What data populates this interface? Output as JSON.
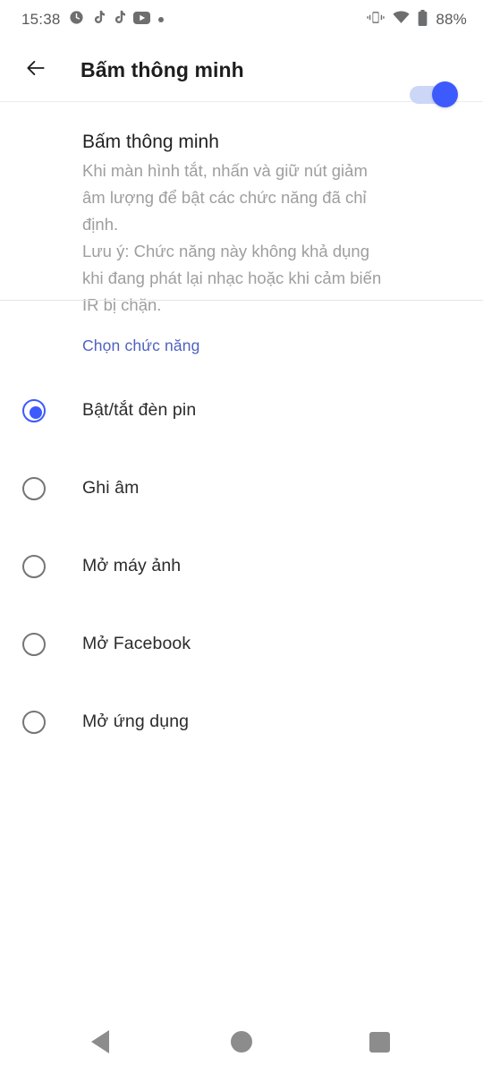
{
  "status_bar": {
    "time": "15:38",
    "battery_text": "88%",
    "left_icons": [
      "clock-icon",
      "tiktok-icon",
      "tiktok-icon",
      "youtube-icon",
      "notification-dot-icon"
    ],
    "right_icons": [
      "vibrate-icon",
      "wifi-icon",
      "battery-icon"
    ],
    "icon_color": "#6d6e70",
    "text_color": "#58595b"
  },
  "app_bar": {
    "back_icon": "arrow-left-icon",
    "title": "Bấm thông minh"
  },
  "master": {
    "title": "Bấm thông minh",
    "description": "Khi màn hình tắt, nhấn và giữ nút giảm âm lượng để bật các chức năng đã chỉ định.\nLưu ý: Chức năng này không khả dụng khi đang phát lại nhạc hoặc khi cảm biến IR bị chặn.",
    "switch_on": true,
    "switch_thumb_color": "#3d5afe",
    "switch_track_color": "#ccd6f7"
  },
  "section": {
    "header": "Chọn chức năng",
    "header_color": "#4f63c0"
  },
  "options": [
    {
      "label": "Bật/tắt đèn pin",
      "selected": true
    },
    {
      "label": "Ghi âm",
      "selected": false
    },
    {
      "label": "Mở máy ảnh",
      "selected": false
    },
    {
      "label": "Mở Facebook",
      "selected": false
    },
    {
      "label": "Mở ứng dụng",
      "selected": false
    }
  ],
  "nav_bar": {
    "back_label": "back-button",
    "home_label": "home-button",
    "recents_label": "recents-button",
    "icon_color": "#8c8c8c"
  }
}
